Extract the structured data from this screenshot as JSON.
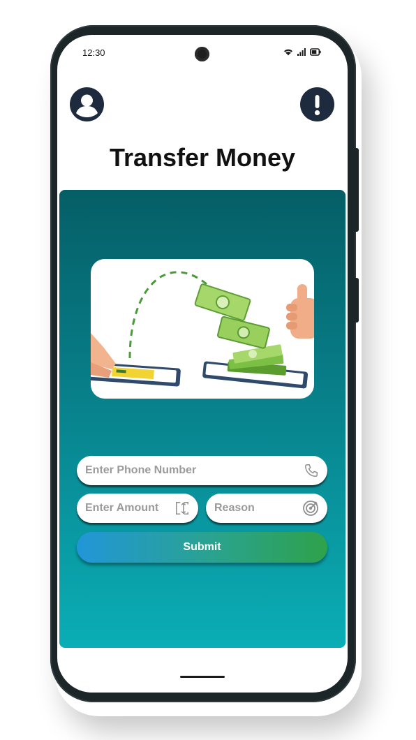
{
  "status_bar": {
    "time": "12:30"
  },
  "header": {
    "title": "Transfer Money",
    "profile_icon": "user-circle-icon",
    "alert_icon": "exclamation-icon"
  },
  "form": {
    "phone_placeholder": "Enter Phone Number",
    "amount_placeholder": "Enter Amount",
    "reason_placeholder": "Reason",
    "submit_label": "Submit"
  },
  "colors": {
    "panel_top": "#055e66",
    "panel_bottom": "#0aaeb6",
    "icon_button": "#1e2a3d",
    "submit_start": "#2196d8",
    "submit_end": "#2ea24a"
  }
}
